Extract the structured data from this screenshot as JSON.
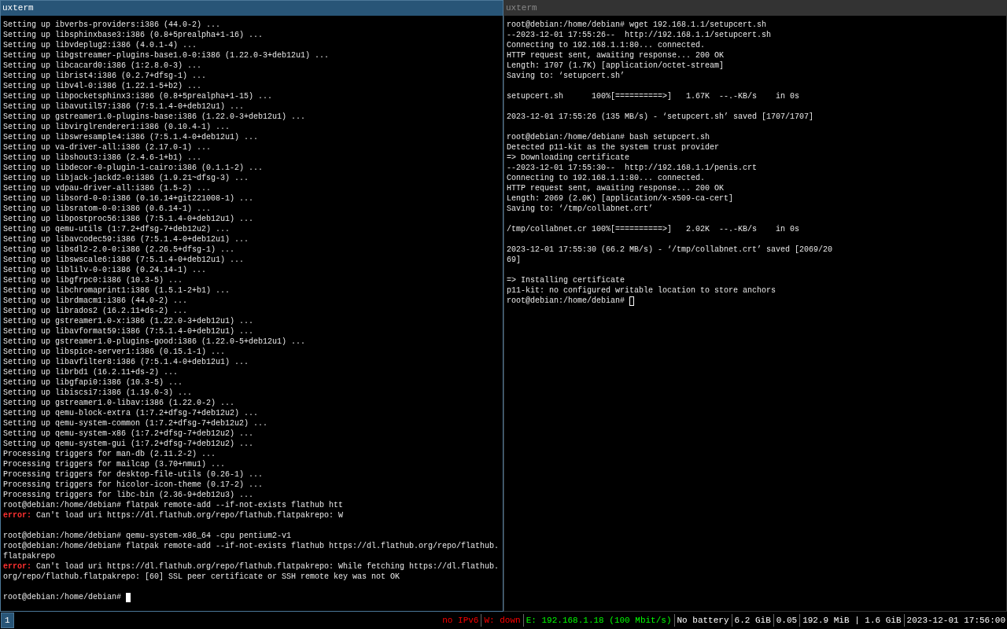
{
  "panes": [
    {
      "title": "uxterm",
      "focused": true,
      "lines": [
        {
          "kind": "plain",
          "text": "Setting up ibverbs-providers:i386 (44.0-2) ..."
        },
        {
          "kind": "plain",
          "text": "Setting up libsphinxbase3:i386 (0.8+5prealpha+1-16) ..."
        },
        {
          "kind": "plain",
          "text": "Setting up libvdeplug2:i386 (4.0.1-4) ..."
        },
        {
          "kind": "plain",
          "text": "Setting up libgstreamer-plugins-base1.0-0:i386 (1.22.0-3+deb12u1) ..."
        },
        {
          "kind": "plain",
          "text": "Setting up libcacard0:i386 (1:2.8.0-3) ..."
        },
        {
          "kind": "plain",
          "text": "Setting up librist4:i386 (0.2.7+dfsg-1) ..."
        },
        {
          "kind": "plain",
          "text": "Setting up libv4l-0:i386 (1.22.1-5+b2) ..."
        },
        {
          "kind": "plain",
          "text": "Setting up libpocketsphinx3:i386 (0.8+5prealpha+1-15) ..."
        },
        {
          "kind": "plain",
          "text": "Setting up libavutil57:i386 (7:5.1.4-0+deb12u1) ..."
        },
        {
          "kind": "plain",
          "text": "Setting up gstreamer1.0-plugins-base:i386 (1.22.0-3+deb12u1) ..."
        },
        {
          "kind": "plain",
          "text": "Setting up libvirglrenderer1:i386 (0.10.4-1) ..."
        },
        {
          "kind": "plain",
          "text": "Setting up libswresample4:i386 (7:5.1.4-0+deb12u1) ..."
        },
        {
          "kind": "plain",
          "text": "Setting up va-driver-all:i386 (2.17.0-1) ..."
        },
        {
          "kind": "plain",
          "text": "Setting up libshout3:i386 (2.4.6-1+b1) ..."
        },
        {
          "kind": "plain",
          "text": "Setting up libdecor-0-plugin-1-cairo:i386 (0.1.1-2) ..."
        },
        {
          "kind": "plain",
          "text": "Setting up libjack-jackd2-0:i386 (1.9.21~dfsg-3) ..."
        },
        {
          "kind": "plain",
          "text": "Setting up vdpau-driver-all:i386 (1.5-2) ..."
        },
        {
          "kind": "plain",
          "text": "Setting up libsord-0-0:i386 (0.16.14+git221008-1) ..."
        },
        {
          "kind": "plain",
          "text": "Setting up libsratom-0-0:i386 (0.6.14-1) ..."
        },
        {
          "kind": "plain",
          "text": "Setting up libpostproc56:i386 (7:5.1.4-0+deb12u1) ..."
        },
        {
          "kind": "plain",
          "text": "Setting up qemu-utils (1:7.2+dfsg-7+deb12u2) ..."
        },
        {
          "kind": "plain",
          "text": "Setting up libavcodec59:i386 (7:5.1.4-0+deb12u1) ..."
        },
        {
          "kind": "plain",
          "text": "Setting up libsdl2-2.0-0:i386 (2.26.5+dfsg-1) ..."
        },
        {
          "kind": "plain",
          "text": "Setting up libswscale6:i386 (7:5.1.4-0+deb12u1) ..."
        },
        {
          "kind": "plain",
          "text": "Setting up liblilv-0-0:i386 (0.24.14-1) ..."
        },
        {
          "kind": "plain",
          "text": "Setting up libgfrpc0:i386 (10.3-5) ..."
        },
        {
          "kind": "plain",
          "text": "Setting up libchromaprint1:i386 (1.5.1-2+b1) ..."
        },
        {
          "kind": "plain",
          "text": "Setting up librdmacm1:i386 (44.0-2) ..."
        },
        {
          "kind": "plain",
          "text": "Setting up librados2 (16.2.11+ds-2) ..."
        },
        {
          "kind": "plain",
          "text": "Setting up gstreamer1.0-x:i386 (1.22.0-3+deb12u1) ..."
        },
        {
          "kind": "plain",
          "text": "Setting up libavformat59:i386 (7:5.1.4-0+deb12u1) ..."
        },
        {
          "kind": "plain",
          "text": "Setting up gstreamer1.0-plugins-good:i386 (1.22.0-5+deb12u1) ..."
        },
        {
          "kind": "plain",
          "text": "Setting up libspice-server1:i386 (0.15.1-1) ..."
        },
        {
          "kind": "plain",
          "text": "Setting up libavfilter8:i386 (7:5.1.4-0+deb12u1) ..."
        },
        {
          "kind": "plain",
          "text": "Setting up librbd1 (16.2.11+ds-2) ..."
        },
        {
          "kind": "plain",
          "text": "Setting up libgfapi0:i386 (10.3-5) ..."
        },
        {
          "kind": "plain",
          "text": "Setting up libiscsi7:i386 (1.19.0-3) ..."
        },
        {
          "kind": "plain",
          "text": "Setting up gstreamer1.0-libav:i386 (1.22.0-2) ..."
        },
        {
          "kind": "plain",
          "text": "Setting up qemu-block-extra (1:7.2+dfsg-7+deb12u2) ..."
        },
        {
          "kind": "plain",
          "text": "Setting up qemu-system-common (1:7.2+dfsg-7+deb12u2) ..."
        },
        {
          "kind": "plain",
          "text": "Setting up qemu-system-x86 (1:7.2+dfsg-7+deb12u2) ..."
        },
        {
          "kind": "plain",
          "text": "Setting up qemu-system-gui (1:7.2+dfsg-7+deb12u2) ..."
        },
        {
          "kind": "plain",
          "text": "Processing triggers for man-db (2.11.2-2) ..."
        },
        {
          "kind": "plain",
          "text": "Processing triggers for mailcap (3.70+nmu1) ..."
        },
        {
          "kind": "plain",
          "text": "Processing triggers for desktop-file-utils (0.26-1) ..."
        },
        {
          "kind": "plain",
          "text": "Processing triggers for hicolor-icon-theme (0.17-2) ..."
        },
        {
          "kind": "plain",
          "text": "Processing triggers for libc-bin (2.36-9+deb12u3) ..."
        },
        {
          "kind": "plain",
          "text": "root@debian:/home/debian# flatpak remote-add --if-not-exists flathub htt"
        },
        {
          "kind": "error",
          "label": "error:",
          "text": " Can't load uri https://dl.flathub.org/repo/flathub.flatpakrepo: W"
        },
        {
          "kind": "blank"
        },
        {
          "kind": "plain",
          "text": "root@debian:/home/debian# qemu-system-x86_64 -cpu pentium2-v1"
        },
        {
          "kind": "plain",
          "text": "root@debian:/home/debian# flatpak remote-add --if-not-exists flathub https://dl.flathub.org/repo/flathub."
        },
        {
          "kind": "plain",
          "text": "flatpakrepo"
        },
        {
          "kind": "error",
          "label": "error:",
          "text": " Can't load uri https://dl.flathub.org/repo/flathub.flatpakrepo: While fetching https://dl.flathub."
        },
        {
          "kind": "plain",
          "text": "org/repo/flathub.flatpakrepo: [60] SSL peer certificate or SSH remote key was not OK"
        },
        {
          "kind": "blank"
        },
        {
          "kind": "prompt",
          "text": "root@debian:/home/debian# ",
          "cursor": true
        }
      ]
    },
    {
      "title": "uxterm",
      "focused": false,
      "lines": [
        {
          "kind": "plain",
          "text": "root@debian:/home/debian# wget 192.168.1.1/setupcert.sh"
        },
        {
          "kind": "plain",
          "text": "--2023-12-01 17:55:26--  http://192.168.1.1/setupcert.sh"
        },
        {
          "kind": "plain",
          "text": "Connecting to 192.168.1.1:80... connected."
        },
        {
          "kind": "plain",
          "text": "HTTP request sent, awaiting response... 200 OK"
        },
        {
          "kind": "plain",
          "text": "Length: 1707 (1.7K) [application/octet-stream]"
        },
        {
          "kind": "plain",
          "text": "Saving to: ‘setupcert.sh’"
        },
        {
          "kind": "blank"
        },
        {
          "kind": "plain",
          "text": "setupcert.sh      100%[==========>]   1.67K  --.-KB/s    in 0s"
        },
        {
          "kind": "blank"
        },
        {
          "kind": "plain",
          "text": "2023-12-01 17:55:26 (135 MB/s) - ‘setupcert.sh’ saved [1707/1707]"
        },
        {
          "kind": "blank"
        },
        {
          "kind": "plain",
          "text": "root@debian:/home/debian# bash setupcert.sh"
        },
        {
          "kind": "plain",
          "text": "Detected p11-kit as the system trust provider"
        },
        {
          "kind": "plain",
          "text": "=> Downloading certificate"
        },
        {
          "kind": "plain",
          "text": "--2023-12-01 17:55:30--  http://192.168.1.1/penis.crt"
        },
        {
          "kind": "plain",
          "text": "Connecting to 192.168.1.1:80... connected."
        },
        {
          "kind": "plain",
          "text": "HTTP request sent, awaiting response... 200 OK"
        },
        {
          "kind": "plain",
          "text": "Length: 2069 (2.0K) [application/x-x509-ca-cert]"
        },
        {
          "kind": "plain",
          "text": "Saving to: ‘/tmp/collabnet.crt’"
        },
        {
          "kind": "blank"
        },
        {
          "kind": "plain",
          "text": "/tmp/collabnet.cr 100%[==========>]   2.02K  --.-KB/s    in 0s"
        },
        {
          "kind": "blank"
        },
        {
          "kind": "plain",
          "text": "2023-12-01 17:55:30 (66.2 MB/s) - ‘/tmp/collabnet.crt’ saved [2069/20"
        },
        {
          "kind": "plain",
          "text": "69]"
        },
        {
          "kind": "blank"
        },
        {
          "kind": "plain",
          "text": "=> Installing certificate"
        },
        {
          "kind": "plain",
          "text": "p11-kit: no configured writable location to store anchors"
        },
        {
          "kind": "prompt",
          "text": "root@debian:/home/debian# ",
          "cursor": true
        }
      ]
    }
  ],
  "status_bar": {
    "workspaces": [
      {
        "label": "1",
        "selected": true
      }
    ],
    "items": [
      {
        "text": "no IPv6",
        "color": "#ff0000"
      },
      {
        "text": "W: down",
        "color": "#ff0000"
      },
      {
        "text": "E: 192.168.1.18 (100 Mbit/s)",
        "color": "#00ff00"
      },
      {
        "text": "No battery"
      },
      {
        "text": "6.2 GiB"
      },
      {
        "text": "0.05"
      },
      {
        "text": "192.9 MiB | 1.6 GiB"
      },
      {
        "text": "2023-12-01 17:56:00"
      }
    ]
  }
}
